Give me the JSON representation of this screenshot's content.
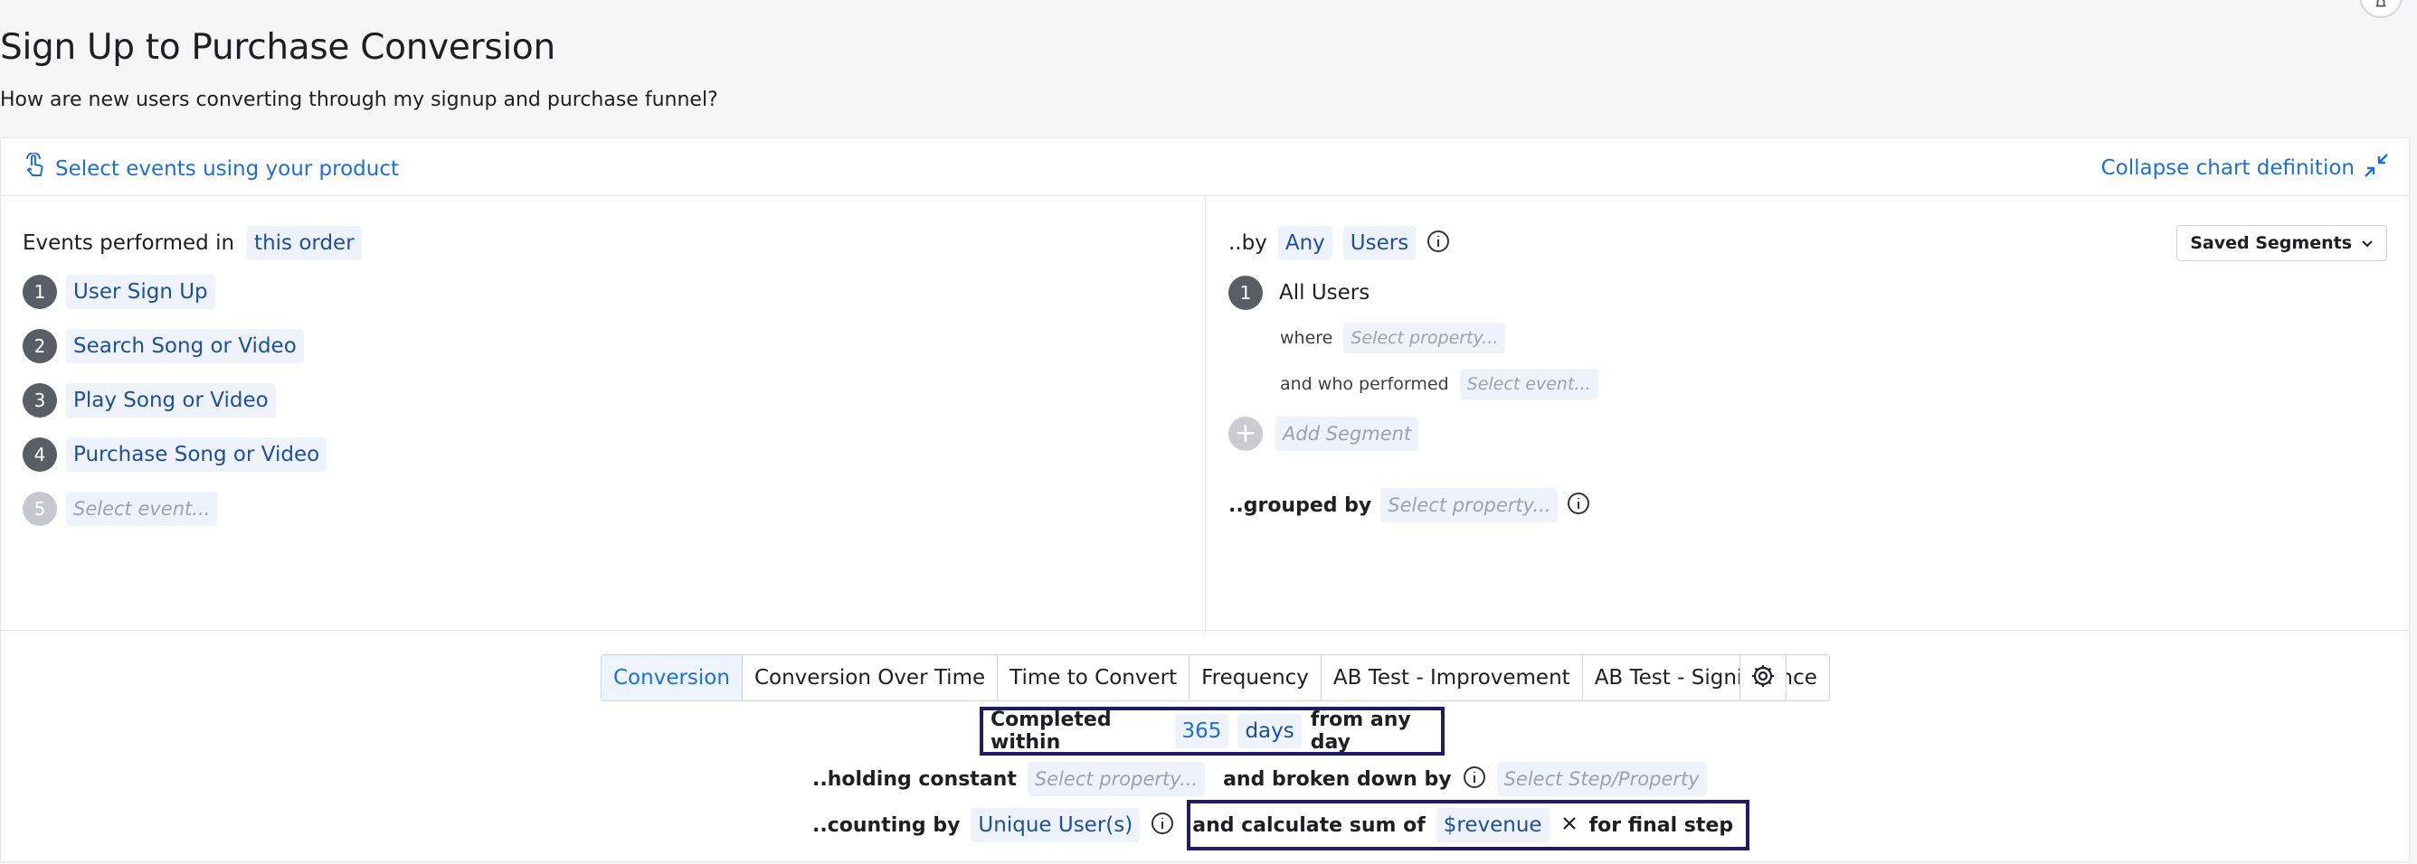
{
  "page": {
    "title": "Sign Up to Purchase Conversion",
    "subtitle": "How are new users converting through my signup and purchase funnel?"
  },
  "header": {
    "select_events_label": "Select events using your product",
    "collapse_label": "Collapse chart definition"
  },
  "events": {
    "label": "Events performed in",
    "order": "this order",
    "steps": [
      {
        "num": "1",
        "label": "User Sign Up"
      },
      {
        "num": "2",
        "label": "Search Song or Video"
      },
      {
        "num": "3",
        "label": "Play Song or Video"
      },
      {
        "num": "4",
        "label": "Purchase Song or Video"
      },
      {
        "num": "5",
        "label": "Select event..."
      }
    ]
  },
  "segments": {
    "by_label": "..by",
    "any": "Any",
    "users": "Users",
    "saved_segments": "Saved Segments",
    "segment_num": "1",
    "segment_name": "All Users",
    "where_label": "where",
    "where_placeholder": "Select property...",
    "who_label": "and who performed",
    "who_placeholder": "Select event...",
    "add_segment": "Add Segment",
    "grouped_label": "..grouped by",
    "grouped_placeholder": "Select property..."
  },
  "tabs": [
    "Conversion",
    "Conversion Over Time",
    "Time to Convert",
    "Frequency",
    "AB Test - Improvement",
    "AB Test - Significance"
  ],
  "active_tab": "Conversion",
  "options": {
    "completed_label": "Completed within",
    "days_value": "365",
    "days_unit": "days",
    "from_label": "from any day",
    "holding_label": "..holding constant",
    "holding_placeholder": "Select property...",
    "broken_label": "and broken down by",
    "broken_placeholder": "Select Step/Property",
    "counting_label": "..counting by",
    "counting_value": "Unique User(s)",
    "sum_label": "and calculate sum of",
    "sum_value": "$revenue",
    "final_label": "for final step"
  },
  "colors": {
    "accent": "#1d6fd8",
    "chip_bg": "#eef3fb",
    "highlight_border": "#1f1a6b"
  }
}
